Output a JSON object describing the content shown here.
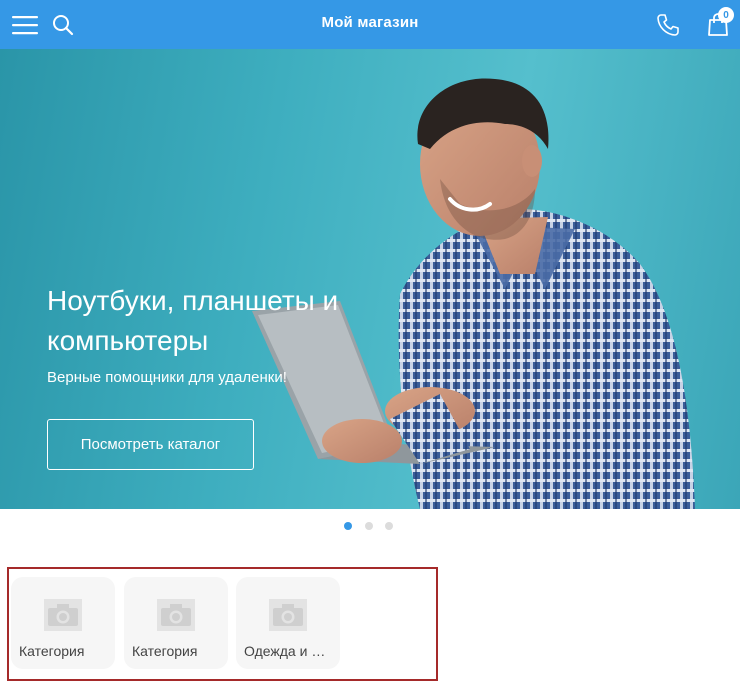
{
  "header": {
    "title": "Мой магазин",
    "cart_count": "0",
    "icons": [
      "menu-icon",
      "search-icon",
      "phone-icon",
      "cart-icon"
    ],
    "accent_color": "#3598e6"
  },
  "banner": {
    "headline": "Ноутбуки, планшеты и компьютеры",
    "subline": "Верные помощники для удаленки!",
    "cta_label": "Посмотреть каталог"
  },
  "slider": {
    "total": 3,
    "active": 1
  },
  "categories": [
    {
      "label": "Категория",
      "icon": "camera-icon"
    },
    {
      "label": "Категория",
      "icon": "camera-icon"
    },
    {
      "label": "Одежда и обувь",
      "icon": "camera-icon"
    }
  ]
}
